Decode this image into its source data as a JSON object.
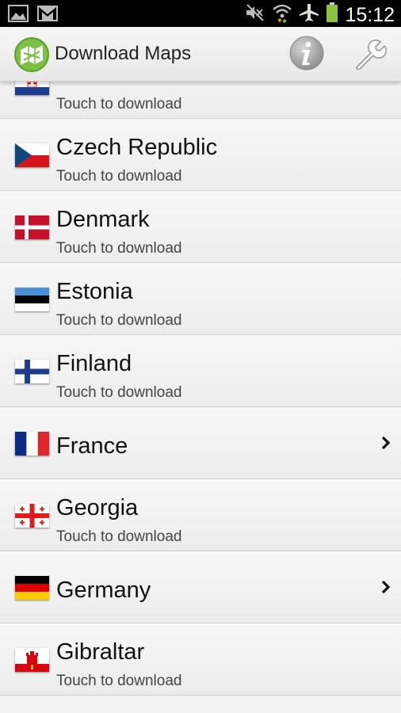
{
  "statusbar": {
    "time": "15:12",
    "icons": [
      "gallery-icon",
      "gmail-icon",
      "no-sound-icon",
      "wifi-icon",
      "airplane-mode-icon",
      "battery-icon"
    ],
    "battery_color": "#8bc53f"
  },
  "actionbar": {
    "title": "Download Maps",
    "logo_color": "#7cc143"
  },
  "list": {
    "items": [
      {
        "name": "",
        "subtitle": "Touch to download",
        "flag": "croatia",
        "has_children": false
      },
      {
        "name": "Czech Republic",
        "subtitle": "Touch to download",
        "flag": "czech",
        "has_children": false
      },
      {
        "name": "Denmark",
        "subtitle": "Touch to download",
        "flag": "denmark",
        "has_children": false
      },
      {
        "name": "Estonia",
        "subtitle": "Touch to download",
        "flag": "estonia",
        "has_children": false
      },
      {
        "name": "Finland",
        "subtitle": "Touch to download",
        "flag": "finland",
        "has_children": false
      },
      {
        "name": "France",
        "subtitle": "",
        "flag": "france",
        "has_children": true
      },
      {
        "name": "Georgia",
        "subtitle": "Touch to download",
        "flag": "georgia",
        "has_children": false
      },
      {
        "name": "Germany",
        "subtitle": "",
        "flag": "germany",
        "has_children": true
      },
      {
        "name": "Gibraltar",
        "subtitle": "Touch to download",
        "flag": "gibraltar",
        "has_children": false
      }
    ]
  }
}
